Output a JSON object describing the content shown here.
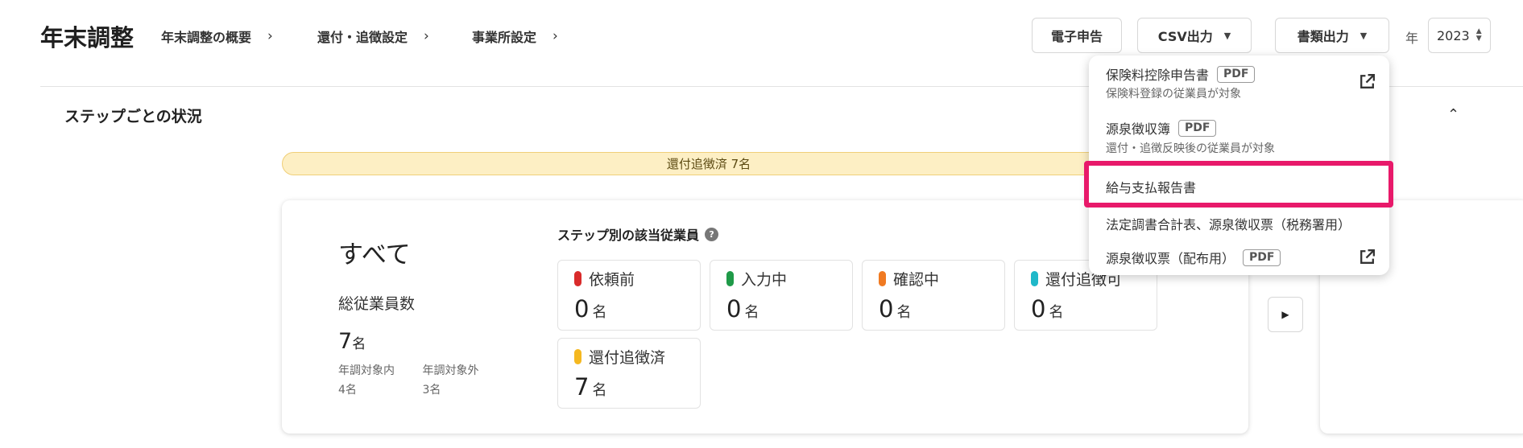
{
  "header": {
    "title": "年末調整",
    "breadcrumbs": [
      {
        "label": "年末調整の概要"
      },
      {
        "label": "還付・追徴設定"
      },
      {
        "label": "事業所設定"
      }
    ],
    "buttons": {
      "e_filing": "電子申告",
      "csv_export": "CSV出力",
      "document_export": "書類出力"
    },
    "year_label": "年",
    "year_value": "2023"
  },
  "section": {
    "title": "ステップごとの状況"
  },
  "progress": {
    "label": "還付追徴済 7名"
  },
  "summary": {
    "all_title": "すべて",
    "total_label": "総従業員数",
    "total_value": "7",
    "unit": "名",
    "inside_label": "年調対象内",
    "inside_value": "4名",
    "outside_label": "年調対象外",
    "outside_value": "3名"
  },
  "steps": {
    "heading": "ステップ別の該当従業員",
    "items": [
      {
        "label": "依頼前",
        "value": "0",
        "unit": "名",
        "color": "#d92b2b"
      },
      {
        "label": "入力中",
        "value": "0",
        "unit": "名",
        "color": "#1f9a48"
      },
      {
        "label": "確認中",
        "value": "0",
        "unit": "名",
        "color": "#f07a22"
      },
      {
        "label": "還付追徴可",
        "value": "0",
        "unit": "名",
        "color": "#1fb8c9"
      },
      {
        "label": "還付追徴済",
        "value": "7",
        "unit": "名",
        "color": "#f5b820"
      }
    ]
  },
  "dropdown": {
    "items": [
      {
        "name": "保険料控除申告書",
        "badge": "PDF",
        "description": "保険料登録の従業員が対象",
        "external": true
      },
      {
        "name": "源泉徴収簿",
        "badge": "PDF",
        "description": "還付・追徴反映後の従業員が対象",
        "external": false
      },
      {
        "name": "給与支払報告書",
        "highlighted": true
      },
      {
        "name": "法定調書合計表、源泉徴収票（税務署用）"
      },
      {
        "name": "源泉徴収票（配布用）",
        "badge": "PDF",
        "external": true
      }
    ]
  },
  "colors": {
    "highlight": "#e8196a",
    "progress_fill": "#fdefc4"
  }
}
